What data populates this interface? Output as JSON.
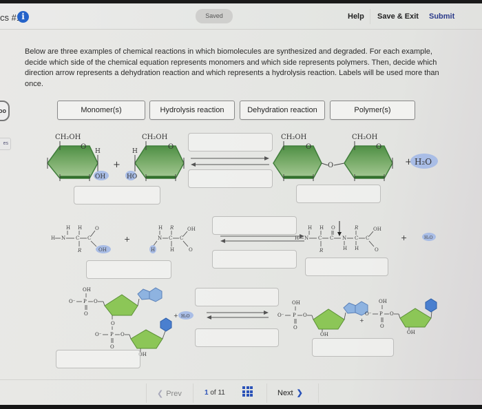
{
  "header": {
    "assignment_title": "cs #1",
    "info_icon": "info-icon",
    "save_status": "Saved",
    "help_label": "Help",
    "save_exit_label": "Save & Exit",
    "submit_label": "Submit"
  },
  "side": {
    "pill_text": "oo",
    "tab_text": "es"
  },
  "instructions": "Below are three examples of chemical reactions in which biomolecules are synthesized and degraded. For each example, decide which side of the chemical equation represents monomers and which side represents polymers. Then, decide which direction arrow represents a dehydration reaction and which represents a hydrolysis reaction. Labels will be used more than once.",
  "labels": [
    {
      "id": "monomers",
      "text": "Monomer(s)"
    },
    {
      "id": "hydrolysis",
      "text": "Hydrolysis reaction"
    },
    {
      "id": "dehydration",
      "text": "Dehydration reaction"
    },
    {
      "id": "polymers",
      "text": "Polymer(s)"
    }
  ],
  "reactions": {
    "carbohydrate": {
      "left": {
        "ch2oh_1": "CH₂OH",
        "ch2oh_2": "CH₂OH",
        "o": "O",
        "h1": "H",
        "h2": "H",
        "oh": "OH",
        "ho": "HO",
        "plus": "+"
      },
      "right": {
        "ch2oh_1": "CH₂OH",
        "ch2oh_2": "CH₂OH",
        "o": "O",
        "bridge_o": "O",
        "plus": "+",
        "water": "H₂O"
      },
      "drop_zones": {
        "left": "",
        "right": "",
        "arrow_top": "",
        "arrow_bottom": ""
      }
    },
    "protein": {
      "left": {
        "h": "H",
        "n": "N",
        "c": "C",
        "r": "R",
        "o": "O",
        "oh": "OH",
        "plus": "+"
      },
      "right": {
        "h": "H",
        "n": "N",
        "c": "C",
        "r": "R",
        "o": "O",
        "oh": "OH",
        "plus": "+",
        "water": "H₂O"
      },
      "drop_zones": {
        "left": "",
        "right": "",
        "arrow_top": "",
        "arrow_bottom": ""
      }
    },
    "nucleic_acid": {
      "left": {
        "oh": "OH",
        "o_minus": "O⁻",
        "p": "P",
        "o": "O",
        "plus": "+",
        "water": "H₂O"
      },
      "right": {
        "oh": "OH",
        "o_minus": "O⁻",
        "p": "P",
        "o": "O",
        "plus": "+"
      },
      "drop_zones": {
        "left": "",
        "right": "",
        "arrow_top": "",
        "arrow_bottom": ""
      }
    }
  },
  "colors": {
    "sugar_green": "#6fa65f",
    "sugar_green_dark": "#3f7d3a",
    "ribose_green": "#8cc657",
    "base_light_blue": "#8eb3e0",
    "base_dark_blue": "#4a7fcf",
    "highlight_blue": "#a9bde6",
    "accent_blue": "#2a52b8"
  },
  "navigation": {
    "prev_label": "Prev",
    "page_current": "1",
    "page_of": "of 11",
    "next_label": "Next",
    "grid_icon": "grid-icon"
  }
}
